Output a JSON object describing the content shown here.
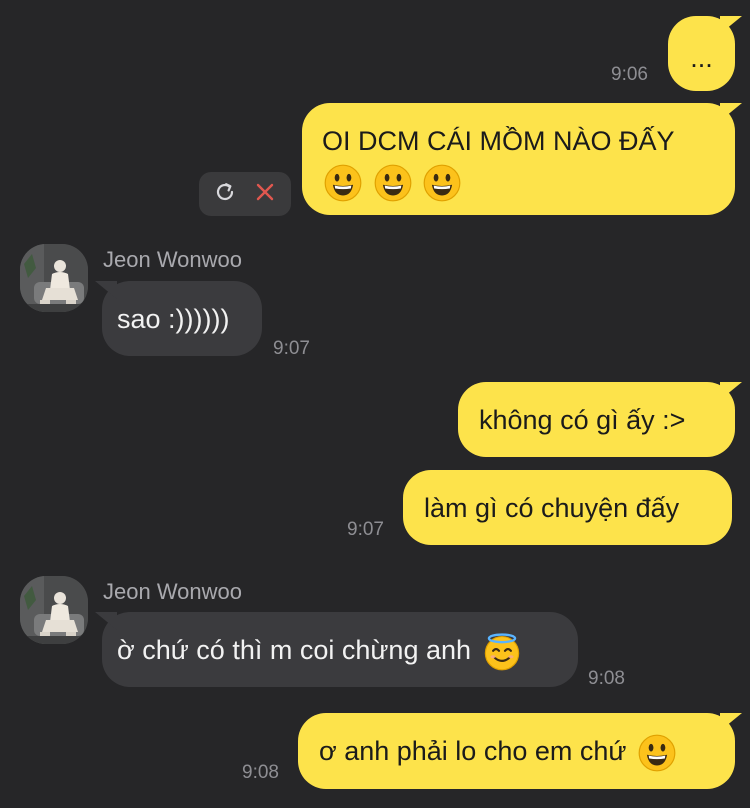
{
  "messages": [
    {
      "text": "...",
      "time": "9:06"
    },
    {
      "text": "OI DCM CÁI MỒM NÀO ĐẤY"
    },
    {
      "sender": "Jeon Wonwoo",
      "text": "sao :))))))",
      "time": "9:07"
    },
    {
      "text": "không có gì ấy :>"
    },
    {
      "text": "làm gì có chuyện đấy",
      "time": "9:07"
    },
    {
      "sender": "Jeon Wonwoo",
      "text": "ờ chứ có thì m coi chừng anh",
      "time": "9:08"
    },
    {
      "text": "ơ anh phải lo cho em chứ",
      "time": "9:08"
    }
  ],
  "icons": {
    "retry": "retry-icon",
    "delete": "close-icon",
    "emoji_grin": "grinning-face-emoji",
    "emoji_halo": "smiling-face-with-halo-emoji"
  },
  "colors": {
    "background": "#262628",
    "outgoing_bubble": "#fde34b",
    "incoming_bubble": "#3b3b3e",
    "timestamp": "#8e8e93",
    "delete_red": "#e0574f"
  }
}
